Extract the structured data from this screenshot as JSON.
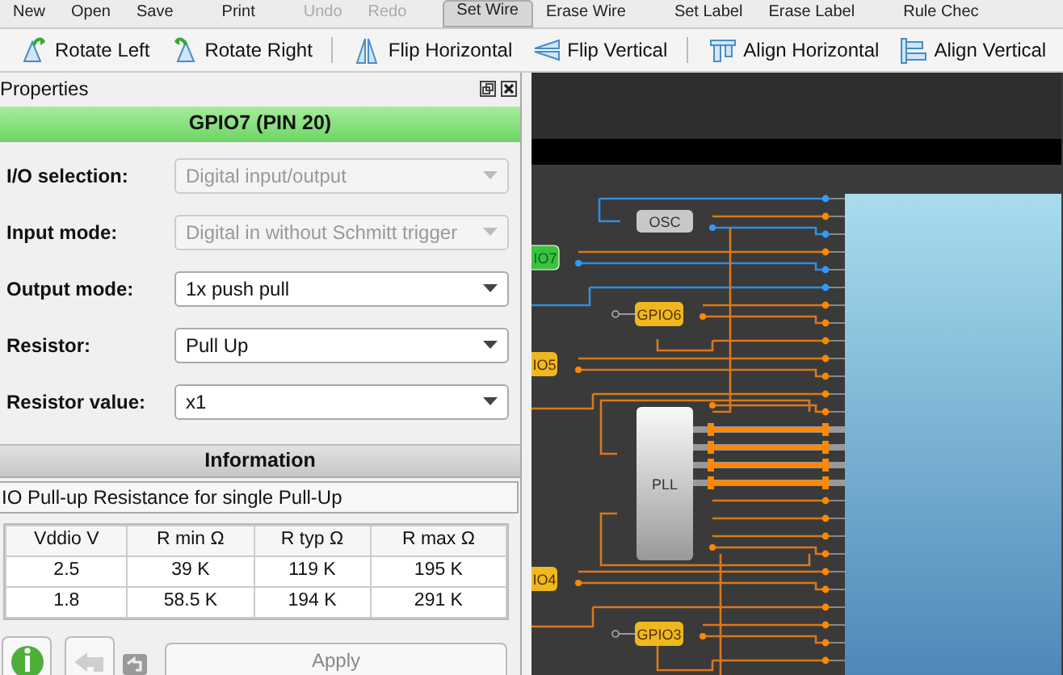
{
  "menu_bar": {
    "items": [
      {
        "label": "New",
        "selected": false,
        "disabled": false
      },
      {
        "label": "Open",
        "selected": false,
        "disabled": false
      },
      {
        "label": "Save",
        "selected": false,
        "disabled": false
      },
      {
        "label": "Print",
        "selected": false,
        "disabled": false
      },
      {
        "label": "Undo",
        "selected": false,
        "disabled": true
      },
      {
        "label": "Redo",
        "selected": false,
        "disabled": true
      },
      {
        "label": "Set Wire",
        "selected": true,
        "disabled": false
      },
      {
        "label": "Erase Wire",
        "selected": false,
        "disabled": false
      },
      {
        "label": "Set Label",
        "selected": false,
        "disabled": false
      },
      {
        "label": "Erase Label",
        "selected": false,
        "disabled": false
      },
      {
        "label": "Rule Chec",
        "selected": false,
        "disabled": false
      }
    ]
  },
  "toolbar": {
    "items": [
      {
        "label": "Rotate Left",
        "kind": "rotate-left"
      },
      {
        "label": "Rotate Right",
        "kind": "rotate-right"
      },
      {
        "label": "Flip Horizontal",
        "kind": "flip-h"
      },
      {
        "label": "Flip Vertical",
        "kind": "flip-v"
      },
      {
        "label": "Align Horizontal",
        "kind": "align-h"
      },
      {
        "label": "Align Vertical",
        "kind": "align-v"
      }
    ]
  },
  "properties_panel": {
    "title": "Properties",
    "header": "GPIO7 (PIN 20)",
    "fields": [
      {
        "label": "I/O selection:",
        "value": "Digital input/output",
        "disabled": true
      },
      {
        "label": "Input mode:",
        "value": "Digital in without Schmitt trigger",
        "disabled": true
      },
      {
        "label": "Output mode:",
        "value": "1x push pull",
        "disabled": false
      },
      {
        "label": "Resistor:",
        "value": "Pull Up",
        "disabled": false
      },
      {
        "label": "Resistor value:",
        "value": "x1",
        "disabled": false
      }
    ],
    "information": {
      "title": "Information",
      "caption": "IO Pull-up Resistance for single Pull-Up",
      "table": {
        "columns": [
          "Vddio V",
          "R min Ω",
          "R typ Ω",
          "R max Ω"
        ],
        "rows": [
          [
            "2.5",
            "39 K",
            "119 K",
            "195 K"
          ],
          [
            "1.8",
            "58.5 K",
            "194 K",
            "291 K"
          ]
        ]
      }
    },
    "buttons": [
      {
        "kind": "info",
        "disabled": false
      },
      {
        "kind": "undo",
        "disabled": true
      },
      {
        "kind": "revert",
        "disabled": true
      },
      {
        "kind": "apply",
        "label": "Apply",
        "disabled": true
      }
    ]
  },
  "canvas": {
    "blocks": [
      {
        "label": "OSC",
        "kind": "osc",
        "selected": false
      },
      {
        "label": "IO7",
        "kind": "gpio",
        "selected": true
      },
      {
        "label": "GPIO6",
        "kind": "gpio",
        "selected": false
      },
      {
        "label": "IO5",
        "kind": "gpio",
        "selected": false
      },
      {
        "label": "PLL",
        "kind": "pll",
        "selected": false
      },
      {
        "label": "IO4",
        "kind": "gpio",
        "selected": false
      },
      {
        "label": "GPIO3",
        "kind": "gpio",
        "selected": false
      }
    ]
  }
}
